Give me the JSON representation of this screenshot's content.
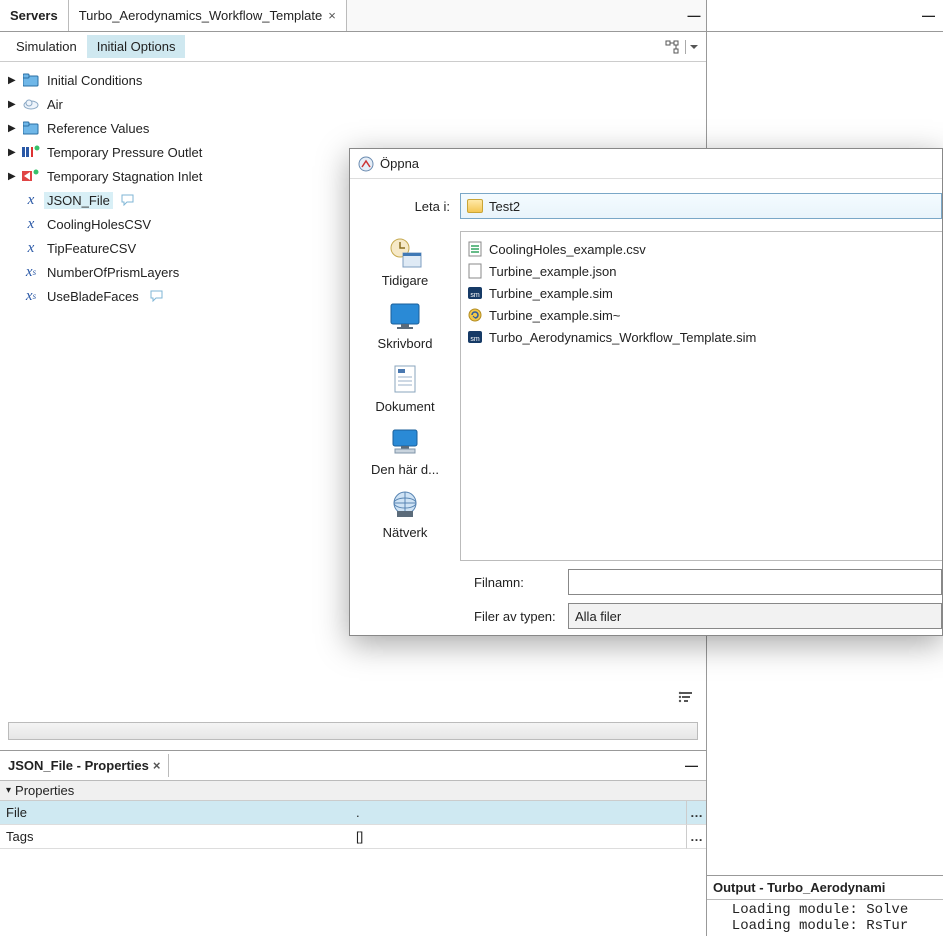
{
  "tabs": {
    "servers": "Servers",
    "workflow": "Turbo_Aerodynamics_Workflow_Template"
  },
  "subtabs": {
    "simulation": "Simulation",
    "initial_options": "Initial Options"
  },
  "tree": {
    "items": [
      {
        "label": "Initial Conditions"
      },
      {
        "label": "Air"
      },
      {
        "label": "Reference Values"
      },
      {
        "label": "Temporary Pressure Outlet"
      },
      {
        "label": "Temporary Stagnation Inlet"
      },
      {
        "label": "JSON_File"
      },
      {
        "label": "CoolingHolesCSV"
      },
      {
        "label": "TipFeatureCSV"
      },
      {
        "label": "NumberOfPrismLayers"
      },
      {
        "label": "UseBladeFaces"
      }
    ]
  },
  "properties": {
    "tab_title": "JSON_File - Properties",
    "section": "Properties",
    "rows": {
      "file_label": "File",
      "file_value": ".",
      "tags_label": "Tags",
      "tags_value": "[]"
    }
  },
  "output": {
    "title": "Output - Turbo_Aerodynami",
    "lines": "  Loading module: Solve\n  Loading module: RsTur"
  },
  "dialog": {
    "title": "Öppna",
    "look_in_label": "Leta i:",
    "look_in_value": "Test2",
    "places": {
      "recent": "Tidigare",
      "desktop": "Skrivbord",
      "documents": "Dokument",
      "computer": "Den här d...",
      "network": "Nätverk"
    },
    "files": [
      "CoolingHoles_example.csv",
      "Turbine_example.json",
      "Turbine_example.sim",
      "Turbine_example.sim~",
      "Turbo_Aerodynamics_Workflow_Template.sim"
    ],
    "filename_label": "Filnamn:",
    "filename_value": "",
    "filetype_label": "Filer av typen:",
    "filetype_value": "Alla filer"
  }
}
